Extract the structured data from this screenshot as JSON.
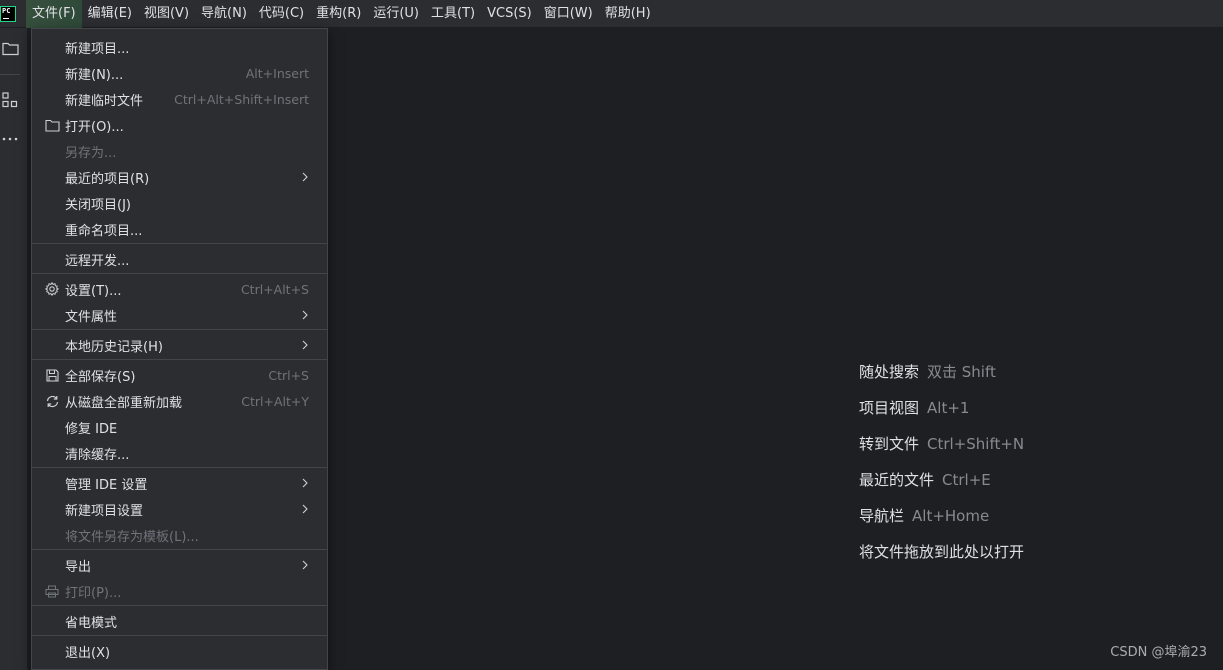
{
  "app": {
    "logo_text": "PC"
  },
  "menubar": {
    "items": [
      {
        "label": "文件(F)"
      },
      {
        "label": "编辑(E)"
      },
      {
        "label": "视图(V)"
      },
      {
        "label": "导航(N)"
      },
      {
        "label": "代码(C)"
      },
      {
        "label": "重构(R)"
      },
      {
        "label": "运行(U)"
      },
      {
        "label": "工具(T)"
      },
      {
        "label": "VCS(S)"
      },
      {
        "label": "窗口(W)"
      },
      {
        "label": "帮助(H)"
      }
    ]
  },
  "file_menu": {
    "items": [
      {
        "label": "新建项目...",
        "shortcut": "",
        "icon": "",
        "submenu": false,
        "disabled": false
      },
      {
        "label": "新建(N)...",
        "shortcut": "Alt+Insert",
        "icon": "",
        "submenu": false,
        "disabled": false
      },
      {
        "label": "新建临时文件",
        "shortcut": "Ctrl+Alt+Shift+Insert",
        "icon": "",
        "submenu": false,
        "disabled": false
      },
      {
        "label": "打开(O)...",
        "shortcut": "",
        "icon": "folder-icon",
        "submenu": false,
        "disabled": false
      },
      {
        "label": "另存为...",
        "shortcut": "",
        "icon": "",
        "submenu": false,
        "disabled": true
      },
      {
        "label": "最近的项目(R)",
        "shortcut": "",
        "icon": "",
        "submenu": true,
        "disabled": false
      },
      {
        "label": "关闭项目(J)",
        "shortcut": "",
        "icon": "",
        "submenu": false,
        "disabled": false
      },
      {
        "label": "重命名项目...",
        "shortcut": "",
        "icon": "",
        "submenu": false,
        "disabled": false
      },
      {
        "label": "远程开发...",
        "shortcut": "",
        "icon": "",
        "submenu": false,
        "disabled": false
      },
      {
        "label": "设置(T)...",
        "shortcut": "Ctrl+Alt+S",
        "icon": "gear-icon",
        "submenu": false,
        "disabled": false
      },
      {
        "label": "文件属性",
        "shortcut": "",
        "icon": "",
        "submenu": true,
        "disabled": false
      },
      {
        "label": "本地历史记录(H)",
        "shortcut": "",
        "icon": "",
        "submenu": true,
        "disabled": false
      },
      {
        "label": "全部保存(S)",
        "shortcut": "Ctrl+S",
        "icon": "save-icon",
        "submenu": false,
        "disabled": false
      },
      {
        "label": "从磁盘全部重新加载",
        "shortcut": "Ctrl+Alt+Y",
        "icon": "reload-icon",
        "submenu": false,
        "disabled": false
      },
      {
        "label": "修复 IDE",
        "shortcut": "",
        "icon": "",
        "submenu": false,
        "disabled": false
      },
      {
        "label": "清除缓存...",
        "shortcut": "",
        "icon": "",
        "submenu": false,
        "disabled": false
      },
      {
        "label": "管理 IDE 设置",
        "shortcut": "",
        "icon": "",
        "submenu": true,
        "disabled": false
      },
      {
        "label": "新建项目设置",
        "shortcut": "",
        "icon": "",
        "submenu": true,
        "disabled": false
      },
      {
        "label": "将文件另存为模板(L)...",
        "shortcut": "",
        "icon": "",
        "submenu": false,
        "disabled": true
      },
      {
        "label": "导出",
        "shortcut": "",
        "icon": "",
        "submenu": true,
        "disabled": false
      },
      {
        "label": "打印(P)...",
        "shortcut": "",
        "icon": "print-icon",
        "submenu": false,
        "disabled": true
      },
      {
        "label": "省电模式",
        "shortcut": "",
        "icon": "",
        "submenu": false,
        "disabled": false
      },
      {
        "label": "退出(X)",
        "shortcut": "",
        "icon": "",
        "submenu": false,
        "disabled": false
      }
    ]
  },
  "editor_hints": [
    {
      "label": "随处搜索",
      "key": "双击 Shift"
    },
    {
      "label": "项目视图",
      "key": "Alt+1"
    },
    {
      "label": "转到文件",
      "key": "Ctrl+Shift+N"
    },
    {
      "label": "最近的文件",
      "key": "Ctrl+E"
    },
    {
      "label": "导航栏",
      "key": "Alt+Home"
    },
    {
      "label": "将文件拖放到此处以打开",
      "key": ""
    }
  ],
  "watermark": "CSDN @埠渝23",
  "colors": {
    "background": "#1e1f22",
    "panel": "#2b2d30",
    "text": "#dfe1e5",
    "muted": "#6f737a",
    "active_menu": "#36503d"
  }
}
